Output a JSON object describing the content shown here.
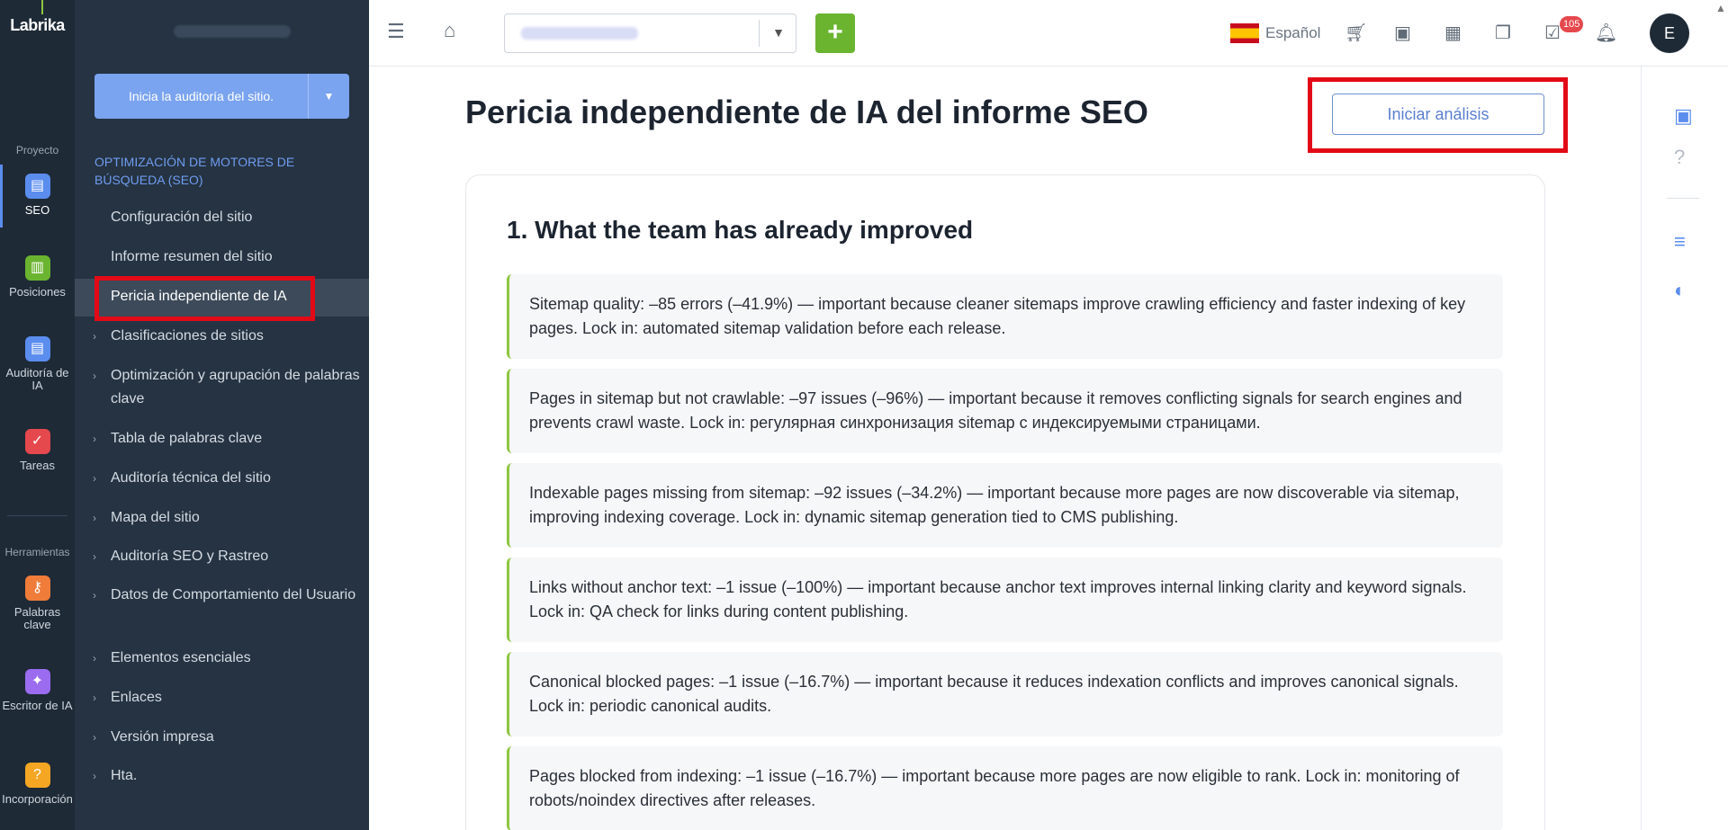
{
  "rail": {
    "logo": "Labrika",
    "group_project": "Proyecto",
    "group_tools": "Herramientas",
    "items": [
      {
        "label": "SEO",
        "color": "#5b8def"
      },
      {
        "label": "Posiciones",
        "color": "#6ab430"
      },
      {
        "label": "Auditoría de IA",
        "color": "#5b8def"
      },
      {
        "label": "Tareas",
        "color": "#e5484d"
      },
      {
        "label": "Palabras clave",
        "color": "#f07c3a"
      },
      {
        "label": "Escritor de IA",
        "color": "#9b6cf0"
      },
      {
        "label": "Incorporación",
        "color": "#f5a623"
      }
    ]
  },
  "sidebar": {
    "audit_button": "Inicia la auditoría del sitio.",
    "section_title": "OPTIMIZACIÓN DE MOTORES DE BÚSQUEDA (SEO)",
    "items": [
      {
        "label": "Configuración del sitio"
      },
      {
        "label": "Informe resumen del sitio"
      },
      {
        "label": "Pericia independiente de IA"
      },
      {
        "label": "Clasificaciones de sitios"
      },
      {
        "label": "Optimización y agrupación de palabras clave"
      },
      {
        "label": "Tabla de palabras clave"
      },
      {
        "label": "Auditoría técnica del sitio"
      },
      {
        "label": "Mapa del sitio"
      },
      {
        "label": "Auditoría SEO y Rastreo"
      },
      {
        "label": "Datos de Comportamiento del Usuario"
      },
      {
        "label": "Elementos esenciales"
      },
      {
        "label": "Enlaces"
      },
      {
        "label": "Versión impresa"
      },
      {
        "label": "Hta."
      }
    ]
  },
  "topbar": {
    "language": "Español",
    "notification_count": "105",
    "avatar_initial": "E",
    "add_label": "+"
  },
  "main": {
    "title": "Pericia independiente de IA del informe SEO",
    "start_button": "Iniciar análisis",
    "section_title": "1. What the team has already improved",
    "items": [
      "Sitemap quality: –85 errors (–41.9%) — important because cleaner sitemaps improve crawling efficiency and faster indexing of key pages. Lock in: automated sitemap validation before each release.",
      "Pages in sitemap but not crawlable: –97 issues (–96%) — important because it removes conflicting signals for search engines and prevents crawl waste. Lock in: регулярная синхронизация sitemap с индексируемыми страницами.",
      "Indexable pages missing from sitemap: –92 issues (–34.2%) — important because more pages are now discoverable via sitemap, improving indexing coverage. Lock in: dynamic sitemap generation tied to CMS publishing.",
      "Links without anchor text: –1 issue (–100%) — important because anchor text improves internal linking clarity and keyword signals. Lock in: QA check for links during content publishing.",
      "Canonical blocked pages: –1 issue (–16.7%) — important because it reduces indexation conflicts and improves canonical signals. Lock in: periodic canonical audits.",
      "Pages blocked from indexing: –1 issue (–16.7%) — important because more pages are now eligible to rank. Lock in: monitoring of robots/noindex directives after releases."
    ]
  },
  "colors": {
    "accent": "#5b8def",
    "highlight": "#e30a17",
    "success": "#8dc63f"
  }
}
